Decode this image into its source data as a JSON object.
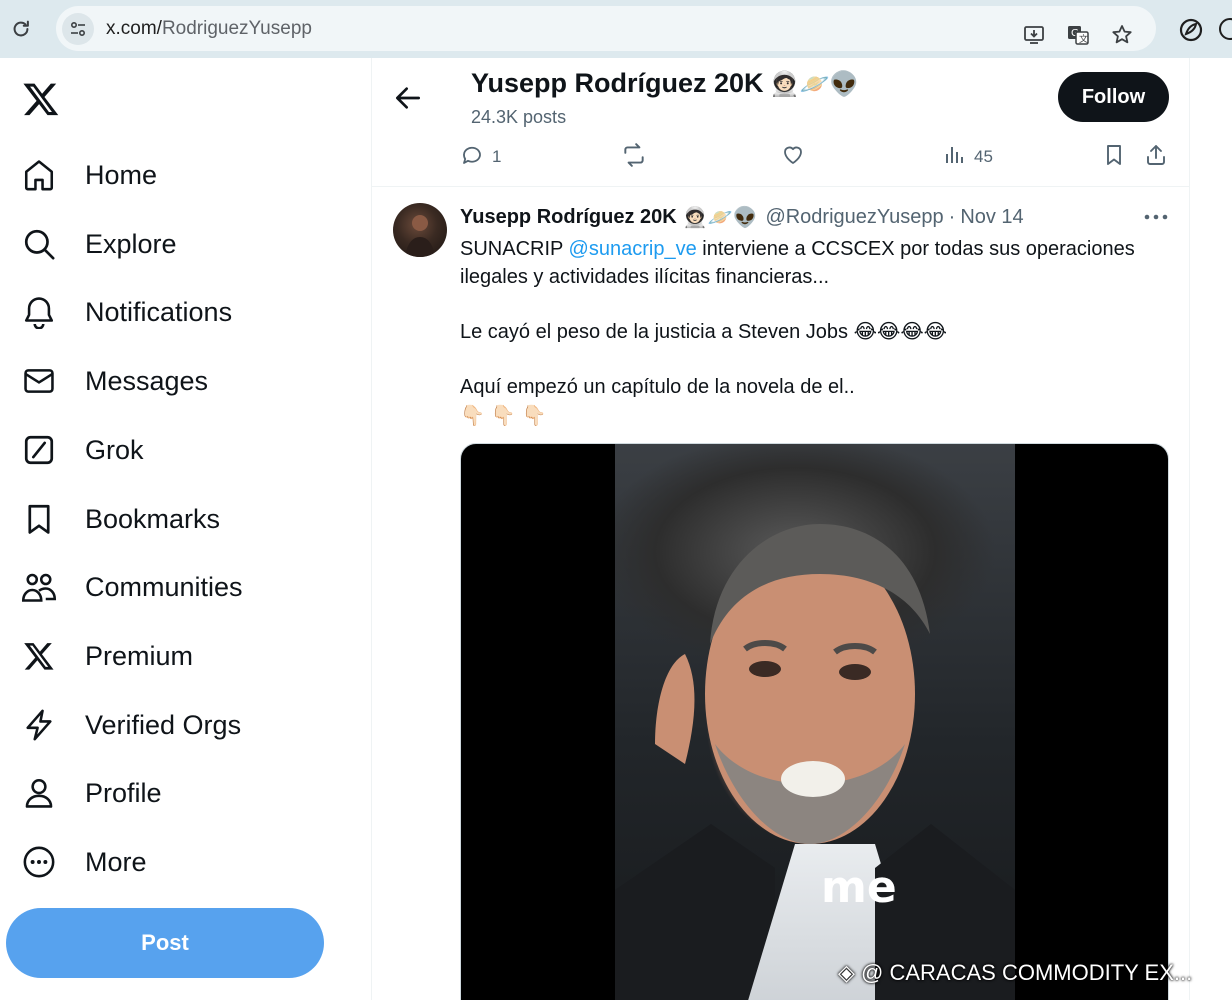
{
  "browser": {
    "url_domain": "x.com/",
    "url_path": "RodriguezYusepp"
  },
  "nav": {
    "items": [
      {
        "label": "Home",
        "icon": "home-icon"
      },
      {
        "label": "Explore",
        "icon": "search-icon"
      },
      {
        "label": "Notifications",
        "icon": "bell-icon"
      },
      {
        "label": "Messages",
        "icon": "envelope-icon"
      },
      {
        "label": "Grok",
        "icon": "grok-icon"
      },
      {
        "label": "Bookmarks",
        "icon": "bookmark-icon"
      },
      {
        "label": "Communities",
        "icon": "people-icon"
      },
      {
        "label": "Premium",
        "icon": "x-icon"
      },
      {
        "label": "Verified Orgs",
        "icon": "lightning-icon"
      },
      {
        "label": "Profile",
        "icon": "person-icon"
      },
      {
        "label": "More",
        "icon": "more-circle-icon"
      }
    ],
    "post_label": "Post"
  },
  "profile": {
    "name": "Yusepp Rodríguez 20K",
    "name_emojis": "🧑🏻‍🚀🪐👽",
    "post_count": "24.3K posts",
    "follow_label": "Follow"
  },
  "actions": {
    "replies": "1",
    "views": "45"
  },
  "tweet": {
    "name": "Yusepp Rodríguez 20K",
    "name_emojis": "🧑🏻‍🚀🪐👽",
    "handle": "@RodriguezYusepp",
    "separator": "·",
    "date": "Nov 14",
    "line1_prefix": "SUNACRIP ",
    "line1_mention": "@sunacrip_ve",
    "line1_suffix": " interviene a CCSCEX por todas sus operaciones ilegales y actividades ilícitas financieras...",
    "line2": "Le cayó el peso de la justicia a Steven Jobs 😂😂😂😂",
    "line3": "Aquí empezó un capítulo de la novela de el..",
    "line4": "👇🏻👇🏻👇🏻"
  },
  "video": {
    "caption": "me",
    "watermark": "@ CARACAS COMMODITY EX..."
  },
  "colors": {
    "accent": "#1d9bf0",
    "post_button": "#57a2ee",
    "follow_button": "#0f1419",
    "secondary_text": "#536471"
  }
}
